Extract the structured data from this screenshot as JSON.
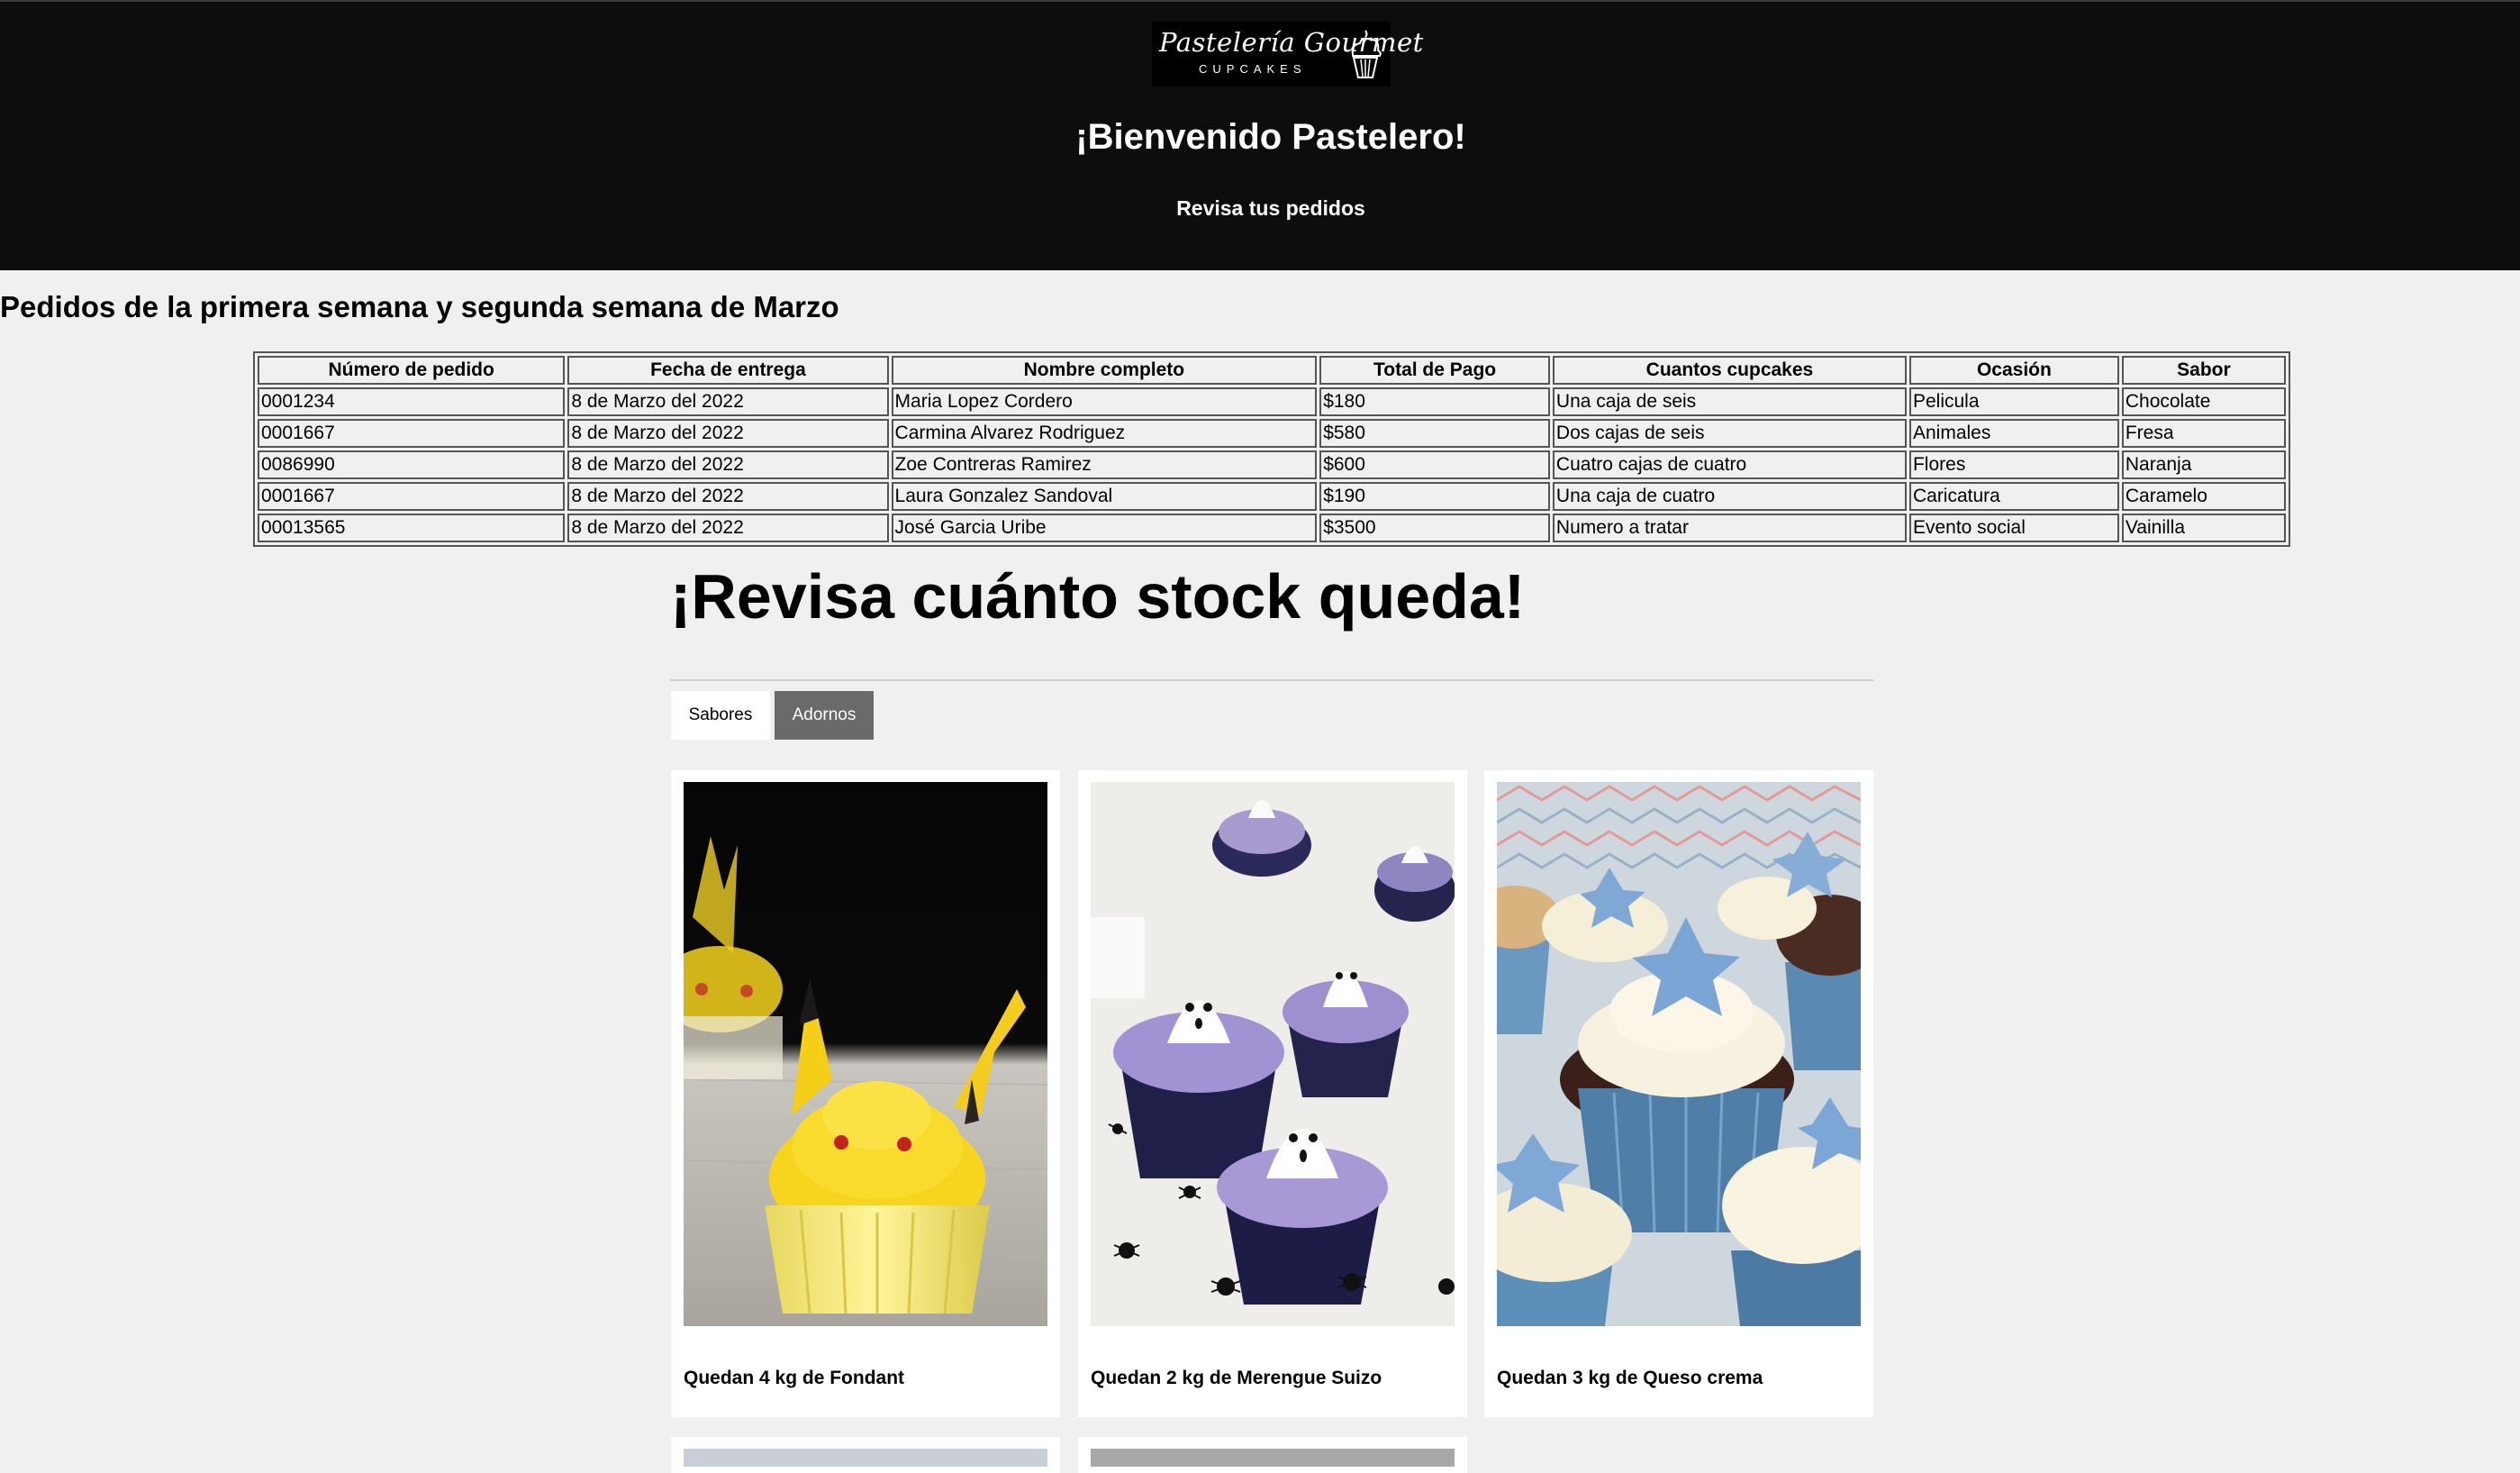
{
  "header": {
    "logo_text": "Pastelería Gourmet",
    "logo_subtext": "CUPCAKES",
    "welcome": "¡Bienvenido Pastelero!",
    "subtitle": "Revisa tus pedidos"
  },
  "orders": {
    "title": "Pedidos de la primera semana y segunda semana de Marzo",
    "columns": [
      "Número de pedido",
      "Fecha de entrega",
      "Nombre completo",
      "Total de Pago",
      "Cuantos cupcakes",
      "Ocasión",
      "Sabor"
    ],
    "rows": [
      [
        "0001234",
        "8 de Marzo del 2022",
        "Maria Lopez Cordero",
        "$180",
        "Una caja de seis",
        "Pelicula",
        "Chocolate"
      ],
      [
        "0001667",
        "8 de Marzo del 2022",
        "Carmina Alvarez Rodriguez",
        "$580",
        "Dos cajas de seis",
        "Animales",
        "Fresa"
      ],
      [
        "0086990",
        "8 de Marzo del 2022",
        "Zoe Contreras Ramirez",
        "$600",
        "Cuatro cajas de cuatro",
        "Flores",
        "Naranja"
      ],
      [
        "0001667",
        "8 de Marzo del 2022",
        "Laura Gonzalez Sandoval",
        "$190",
        "Una caja de cuatro",
        "Caricatura",
        "Caramelo"
      ],
      [
        "00013565",
        "8 de Marzo del 2022",
        "José Garcia Uribe",
        "$3500",
        "Numero a tratar",
        "Evento social",
        "Vainilla"
      ]
    ]
  },
  "stock": {
    "title": "¡Revisa cuánto stock queda!",
    "tabs": [
      {
        "label": "Sabores",
        "active": false
      },
      {
        "label": "Adornos",
        "active": true
      }
    ],
    "cards": [
      {
        "caption": "Quedan 4 kg de Fondant",
        "image": "pikachu-cupcake-photo"
      },
      {
        "caption": "Quedan 2 kg de Merengue Suizo",
        "image": "ghost-meringue-cupcakes-photo"
      },
      {
        "caption": "Quedan 3 kg de Queso crema",
        "image": "star-cupcakes-photo"
      }
    ]
  },
  "colors": {
    "header_bg": "#0d0d0d",
    "page_bg": "#f0f0f0",
    "active_tab_bg": "#6a6a6a",
    "card_bg": "#ffffff"
  }
}
